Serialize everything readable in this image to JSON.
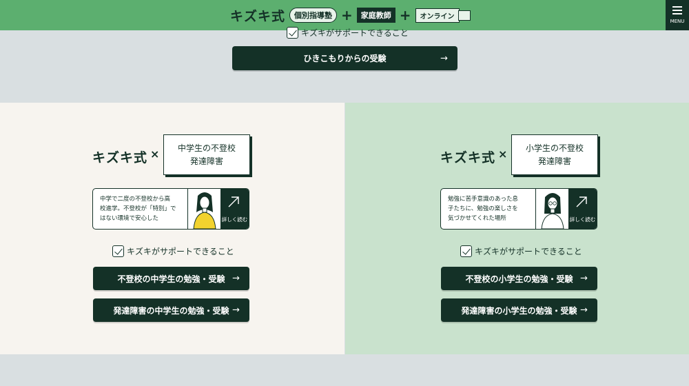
{
  "header": {
    "logo": "キズキ式",
    "tag_individual": "個別指導塾",
    "tag_tutor": "家庭教師",
    "tag_online": "オンライン",
    "plus": "+",
    "menu_label": "MENU"
  },
  "top": {
    "check_label": "キズキがサポートできること",
    "button_label": "ひきこもりからの受験",
    "arrow": "→"
  },
  "colors": {
    "header_bg": "#5caf6f",
    "dark": "#143127",
    "page_bg": "#d9dfe1",
    "left_panel_bg": "#f7f4ef",
    "right_panel_bg": "#c9e2cd"
  },
  "panels": [
    {
      "logo": "キズキ式",
      "x_mark": "×",
      "title_line1": "中学生の不登校",
      "title_line2": "発達障害",
      "card_line1": "中学で二度の不登校から高",
      "card_line2": "校進学。不登校が「特別」で",
      "card_line3": "はない環境で安心した",
      "more_label": "詳しく読む",
      "check_label": "キズキがサポートできること",
      "button1_label": "不登校の中学生の勉強・受験",
      "button2_label": "発達障害の中学生の勉強・受験",
      "arrow": "→"
    },
    {
      "logo": "キズキ式",
      "x_mark": "×",
      "title_line1": "小学生の不登校",
      "title_line2": "発達障害",
      "card_line1": "勉強に苦手意識のあった息",
      "card_line2": "子たちに、勉強の楽しさを",
      "card_line3": "気づかせてくれた場所",
      "more_label": "詳しく読む",
      "check_label": "キズキがサポートできること",
      "button1_label": "不登校の小学生の勉強・受験",
      "button2_label": "発達障害の小学生の勉強・受験",
      "arrow": "→"
    }
  ]
}
